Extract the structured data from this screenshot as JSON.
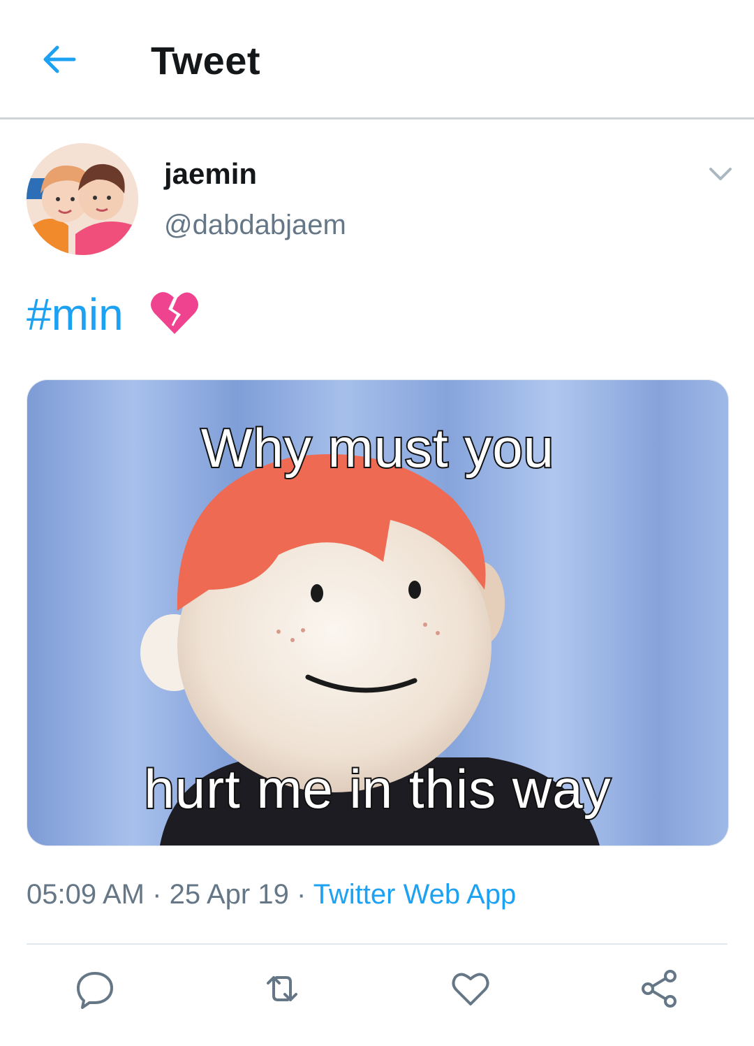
{
  "header": {
    "back_icon": "arrow-left-icon",
    "title": "Tweet"
  },
  "tweet": {
    "author": {
      "display_name": "jaemin",
      "handle": "@dabdabjaem"
    },
    "more_icon": "chevron-down-icon",
    "text": {
      "hashtag": "#min",
      "emoji": "broken-heart"
    },
    "media": {
      "caption_top": "Why must you",
      "caption_bottom": "hurt me in this way"
    },
    "meta": {
      "time": "05:09 AM",
      "date": "25 Apr 19",
      "source": "Twitter Web App"
    },
    "actions": [
      "reply-icon",
      "retweet-icon",
      "like-icon",
      "share-icon"
    ]
  },
  "colors": {
    "accent": "#1da1f2",
    "secondary_text": "#657786",
    "primary_text": "#14171a",
    "broken_heart": "#f0438f"
  }
}
